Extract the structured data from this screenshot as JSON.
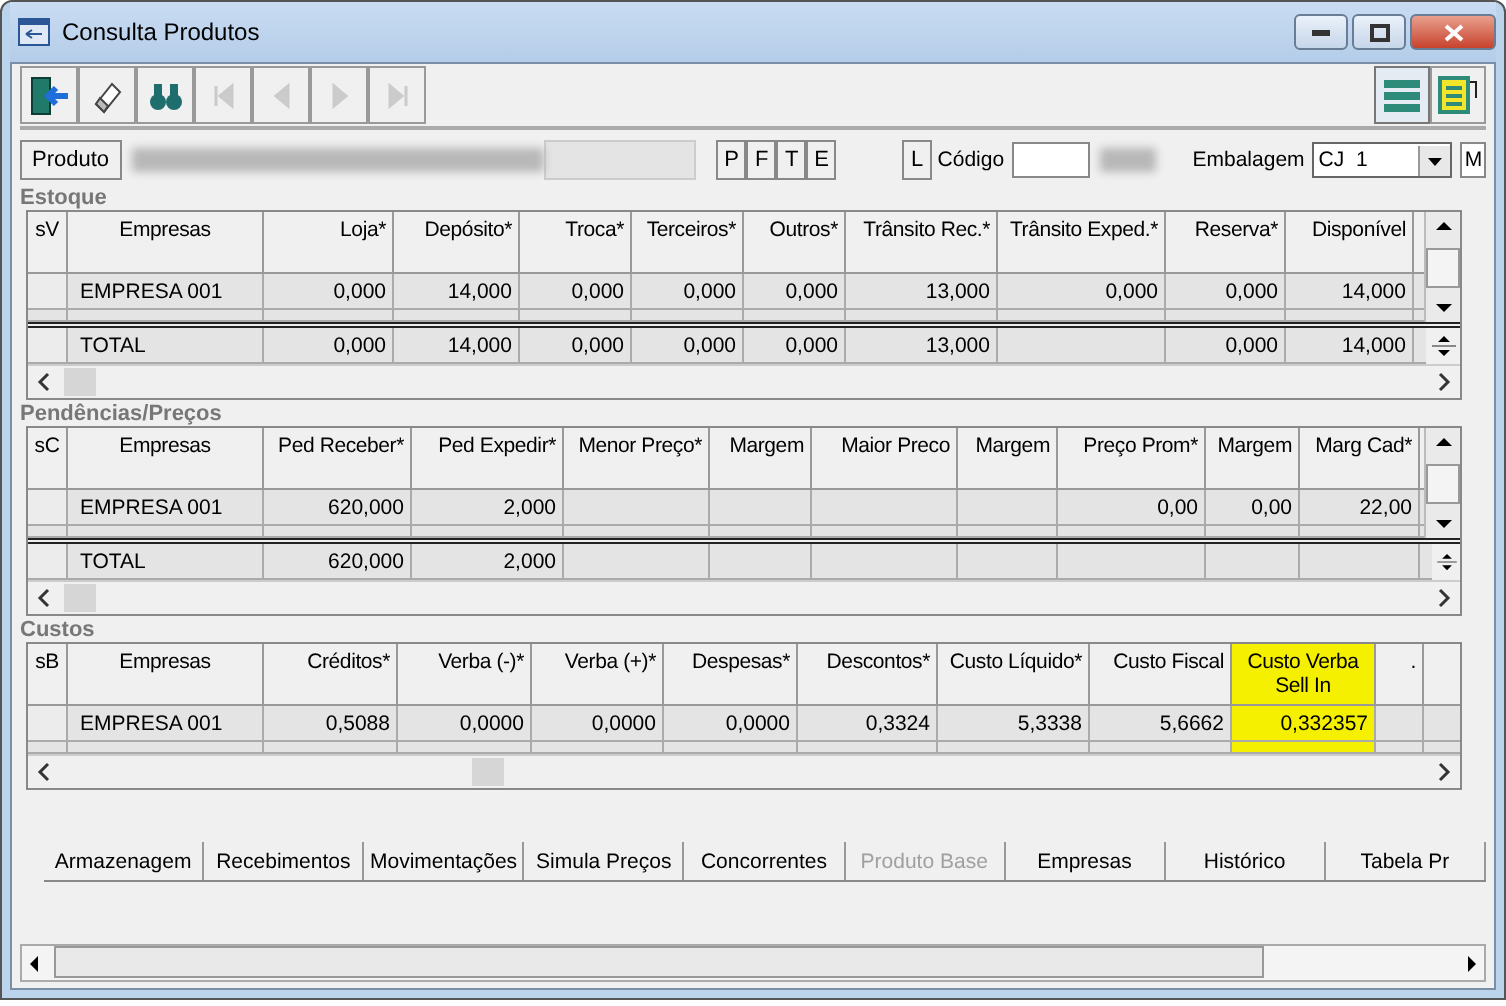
{
  "window": {
    "title": "Consulta Produtos"
  },
  "toolbar": {
    "buttons": [
      {
        "kind": "exit",
        "disabled": false
      },
      {
        "kind": "eraser",
        "disabled": false
      },
      {
        "kind": "search",
        "disabled": false
      },
      {
        "kind": "first",
        "disabled": true
      },
      {
        "kind": "prev",
        "disabled": true
      },
      {
        "kind": "next",
        "disabled": true
      },
      {
        "kind": "last",
        "disabled": true
      }
    ],
    "view_buttons": [
      {
        "kind": "list",
        "selected": true
      },
      {
        "kind": "form",
        "selected": false
      }
    ]
  },
  "product_bar": {
    "produto_button": "Produto",
    "letter_buttons": [
      "P",
      "F",
      "T",
      "E"
    ],
    "l_button": "L",
    "codigo_label": "Código",
    "embalagem_label": "Embalagem",
    "embalagem_value": "CJ  1",
    "m_field": "M"
  },
  "sections": [
    {
      "title": "Estoque",
      "columns": [
        {
          "label": "sV",
          "highlighted": false
        },
        {
          "label": "Empresas",
          "highlighted": false
        },
        {
          "label": "Loja*",
          "highlighted": false
        },
        {
          "label": "Depósito*",
          "highlighted": false
        },
        {
          "label": "Troca*",
          "highlighted": false
        },
        {
          "label": "Terceiros*",
          "highlighted": false
        },
        {
          "label": "Outros*",
          "highlighted": false
        },
        {
          "label": "Trânsito Rec.*",
          "highlighted": false
        },
        {
          "label": "Trânsito Exped.*",
          "highlighted": false
        },
        {
          "label": "Reserva*",
          "highlighted": false
        },
        {
          "label": "Disponível",
          "highlighted": false
        }
      ],
      "rows": [
        {
          "cells": [
            null,
            "EMPRESA 001",
            "0,000",
            "14,000",
            "0,000",
            "0,000",
            "0,000",
            "13,000",
            "0,000",
            "0,000",
            "14,000"
          ]
        }
      ],
      "total": {
        "cells": [
          null,
          "TOTAL",
          "0,000",
          "14,000",
          "0,000",
          "0,000",
          "0,000",
          "13,000",
          null,
          "0,000",
          "14,000"
        ]
      }
    },
    {
      "title": "Pendências/Preços",
      "columns": [
        {
          "label": "sC",
          "highlighted": false
        },
        {
          "label": "Empresas",
          "highlighted": false
        },
        {
          "label": "Ped Receber*",
          "highlighted": false
        },
        {
          "label": "Ped Expedir*",
          "highlighted": false
        },
        {
          "label": "Menor Preço*",
          "highlighted": false
        },
        {
          "label": "Margem",
          "highlighted": false
        },
        {
          "label": "Maior Preco",
          "highlighted": false
        },
        {
          "label": "Margem",
          "highlighted": false
        },
        {
          "label": "Preço Prom*",
          "highlighted": false
        },
        {
          "label": "Margem",
          "highlighted": false
        },
        {
          "label": "Marg Cad*",
          "highlighted": false
        }
      ],
      "rows": [
        {
          "cells": [
            null,
            "EMPRESA 001",
            "620,000",
            "2,000",
            null,
            null,
            null,
            null,
            "0,00",
            "0,00",
            "22,00"
          ]
        }
      ],
      "total": {
        "cells": [
          null,
          "TOTAL",
          "620,000",
          "2,000",
          null,
          null,
          null,
          null,
          null,
          null,
          null
        ]
      }
    },
    {
      "title": "Custos",
      "columns": [
        {
          "label": "sB",
          "highlighted": false
        },
        {
          "label": "Empresas",
          "highlighted": false
        },
        {
          "label": "Créditos*",
          "highlighted": false
        },
        {
          "label": "Verba (-)*",
          "highlighted": false
        },
        {
          "label": "Verba (+)*",
          "highlighted": false
        },
        {
          "label": "Despesas*",
          "highlighted": false
        },
        {
          "label": "Descontos*",
          "highlighted": false
        },
        {
          "label": "Custo Líquido*",
          "highlighted": false
        },
        {
          "label": "Custo Fiscal",
          "highlighted": false
        },
        {
          "label": "Custo Verba Sell In",
          "highlighted": true
        },
        {
          "label": ".",
          "highlighted": false
        }
      ],
      "rows": [
        {
          "cells": [
            null,
            "EMPRESA 001",
            "0,5088",
            "0,0000",
            "0,0000",
            "0,0000",
            "0,3324",
            "5,3338",
            "5,6662",
            "0,332357",
            null
          ]
        }
      ]
    }
  ],
  "tabs": [
    {
      "label": "Armazenagem",
      "disabled": false
    },
    {
      "label": "Recebimentos",
      "disabled": false
    },
    {
      "label": "Movimentações",
      "disabled": false
    },
    {
      "label": "Simula Preços",
      "disabled": false
    },
    {
      "label": "Concorrentes",
      "disabled": false
    },
    {
      "label": "Produto Base",
      "disabled": true
    },
    {
      "label": "Empresas",
      "disabled": false
    },
    {
      "label": "Histórico",
      "disabled": false
    },
    {
      "label": "Tabela Pr",
      "disabled": false
    }
  ]
}
